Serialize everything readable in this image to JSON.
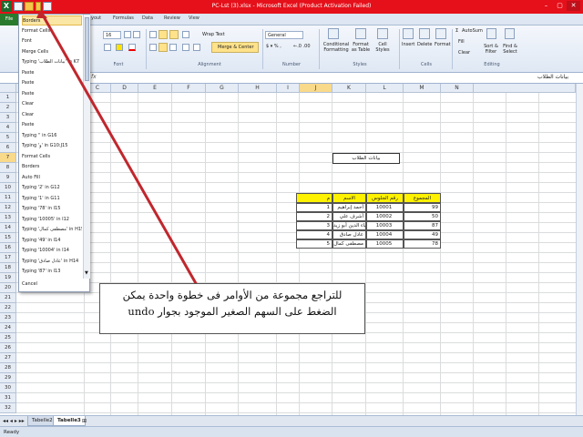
{
  "window": {
    "title": "PC-Lst (3).xlsx - Microsoft Excel (Product Activation Failed)",
    "controls": [
      "–",
      "▢",
      "✕"
    ]
  },
  "ribbon": {
    "file_label": "File",
    "tabs": [
      "Home",
      "Insert",
      "Page Layout",
      "Formulas",
      "Data",
      "Review",
      "View"
    ],
    "font_size": "16",
    "wrap_text": "Wrap Text",
    "number_format": "General",
    "merge_center": "Merge & Center",
    "conditional_formatting": "Conditional Formatting",
    "format_as_table": "Format as Table",
    "cell_styles": "Cell Styles",
    "insert": "Insert",
    "delete": "Delete",
    "format": "Format",
    "autosum": "AutoSum",
    "fill": "Fill",
    "clear": "Clear",
    "sort_filter": "Sort & Filter",
    "find_select": "Find & Select",
    "groups": [
      "Font",
      "Alignment",
      "Number",
      "Styles",
      "Cells",
      "Editing"
    ]
  },
  "formula_bar": {
    "fx": "fx",
    "value": "بيانات الطلاب"
  },
  "undo_list": {
    "items": [
      "Borders",
      "Format Cells",
      "Font",
      "Merge Cells",
      "Typing 'بيانات الطلاب' in K7",
      "Paste",
      "Paste",
      "Paste",
      "Clear",
      "Clear",
      "Paste",
      "Typing '' in G16",
      "Typing 'و' in G10:J15",
      "Format Cells",
      "Borders",
      "Auto Fill",
      "Typing '2' in G12",
      "Typing '1' in G11",
      "Typing '78' in I15",
      "Typing '10005' in I12",
      "Typing 'مصطفى كمال' in H15",
      "Typing '49' in I14",
      "Typing '10004' in I14",
      "Typing 'عادل صادق' in H14",
      "Typing '87' in I13"
    ],
    "cancel": "Cancel"
  },
  "grid": {
    "columns": [
      "C",
      "D",
      "E",
      "F",
      "G",
      "H",
      "I",
      "J",
      "K",
      "L",
      "M",
      "N"
    ],
    "selected_column": "J",
    "rows": [
      "1",
      "2",
      "3",
      "4",
      "5",
      "6",
      "7",
      "8",
      "9",
      "10",
      "11",
      "12",
      "13",
      "14",
      "15",
      "16",
      "17",
      "18",
      "19",
      "20",
      "21",
      "22",
      "23",
      "24",
      "25",
      "26",
      "27",
      "28",
      "29",
      "30",
      "31",
      "32"
    ],
    "selected_row": "7",
    "title_cell": "بيانات الطلاب",
    "header_row": {
      "total": "المجموع",
      "seat": "رقم الجلوس",
      "name": "الاسم",
      "num": "م"
    },
    "data_rows": [
      {
        "total": "99",
        "seat": "10001",
        "name": "أحمد إبراهيم",
        "num": "1"
      },
      {
        "total": "50",
        "seat": "10002",
        "name": "أشرف علي",
        "num": "2"
      },
      {
        "total": "87",
        "seat": "10003",
        "name": "بهاء الدين أبو زيد",
        "num": "3"
      },
      {
        "total": "49",
        "seat": "10004",
        "name": "عادل صادق",
        "num": "4"
      },
      {
        "total": "78",
        "seat": "10005",
        "name": "مصطفى كمال",
        "num": "5"
      }
    ]
  },
  "callout": {
    "line1": "للتراجع مجموعة من الأوامر فى خطوة واحدة يمكن",
    "line2": "الضغط على السهم الصغير الموجود بجوار undo"
  },
  "sheets": [
    "Tabelle2",
    "Tabelle3"
  ],
  "active_sheet": "Tabelle3",
  "status": "Ready",
  "colors": {
    "title_bar": "#e5101a",
    "arrow": "#c0272d",
    "header_fill": "#fff200"
  }
}
